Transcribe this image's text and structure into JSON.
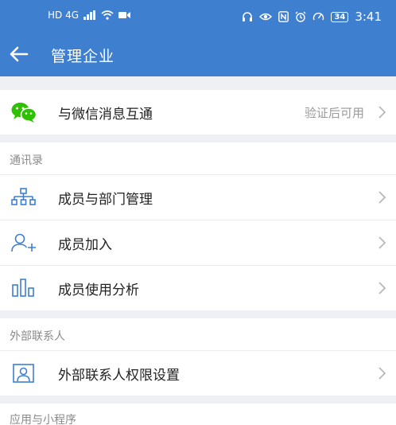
{
  "status_bar": {
    "left_badges": "HD 4G",
    "battery": "34",
    "time": "3:41"
  },
  "header": {
    "title": "管理企业"
  },
  "wechat_row": {
    "label": "与微信消息互通",
    "value": "验证后可用"
  },
  "sections": [
    {
      "title": "通讯录",
      "items": [
        {
          "label": "成员与部门管理",
          "icon": "org-chart-icon"
        },
        {
          "label": "成员加入",
          "icon": "add-person-icon"
        },
        {
          "label": "成员使用分析",
          "icon": "bar-chart-icon"
        }
      ]
    },
    {
      "title": "外部联系人",
      "items": [
        {
          "label": "外部联系人权限设置",
          "icon": "contact-card-icon"
        }
      ]
    },
    {
      "title": "应用与小程序",
      "items": []
    }
  ],
  "colors": {
    "header": "#3f7fd0",
    "accent_icon": "#3f7fd0",
    "wechat_green": "#2dc100",
    "background": "#eef0f4"
  }
}
